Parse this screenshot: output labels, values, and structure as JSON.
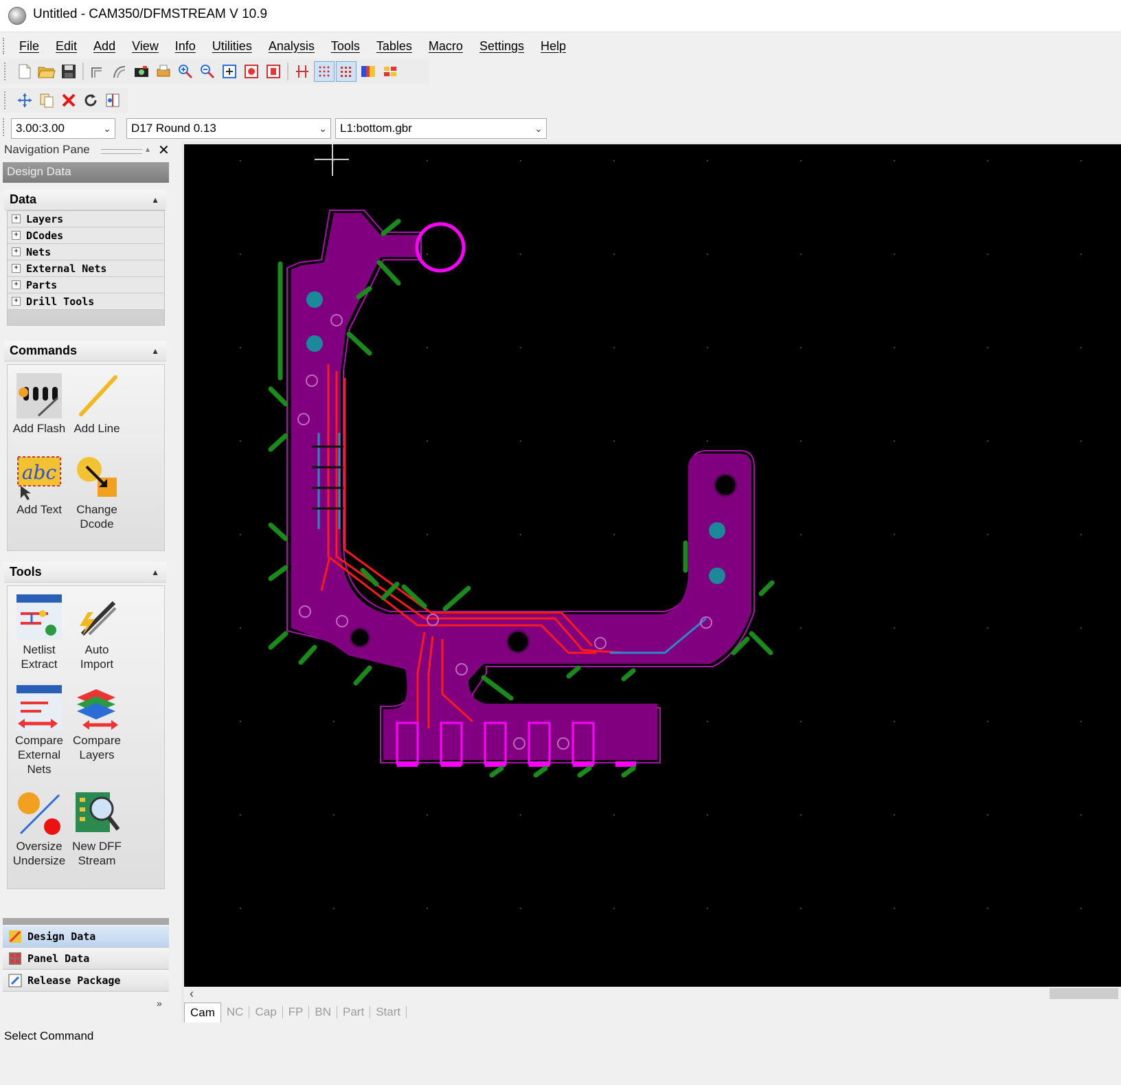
{
  "window": {
    "title": "Untitled - CAM350/DFMSTREAM V 10.9"
  },
  "menu": [
    "File",
    "Edit",
    "Add",
    "View",
    "Info",
    "Utilities",
    "Analysis",
    "Tools",
    "Tables",
    "Macro",
    "Settings",
    "Help"
  ],
  "toolbar": {
    "grid_combo": "3.00:3.00",
    "dcode_combo": "D17  Round 0.13",
    "layer_combo": "L1:bottom.gbr"
  },
  "nav": {
    "title": "Navigation Pane",
    "header": "Design Data",
    "data_section": {
      "title": "Data",
      "items": [
        "Layers",
        "DCodes",
        "Nets",
        "External Nets",
        "Parts",
        "Drill Tools"
      ]
    },
    "commands_section": {
      "title": "Commands",
      "items": [
        {
          "label": "Add Flash"
        },
        {
          "label": "Add Line"
        },
        {
          "label": "Add Text"
        },
        {
          "label": "Change Dcode"
        }
      ]
    },
    "tools_section": {
      "title": "Tools",
      "items": [
        {
          "label": "Netlist Extract"
        },
        {
          "label": "Auto Import"
        },
        {
          "label": "Compare External Nets"
        },
        {
          "label": "Compare Layers"
        },
        {
          "label": "Oversize Undersize"
        },
        {
          "label": "New DFF Stream"
        }
      ]
    },
    "bottom_buttons": [
      "Design Data",
      "Panel Data",
      "Release Package"
    ]
  },
  "tabs": [
    "Cam",
    "NC",
    "Cap",
    "FP",
    "BN",
    "Part",
    "Start"
  ],
  "status": {
    "text": "Select Command"
  },
  "colors": {
    "copper": "#800080",
    "trace": "#ff1a1a",
    "silk": "#1a8a1a",
    "pad": "#ff00ff",
    "via": "#1a8a9a"
  }
}
